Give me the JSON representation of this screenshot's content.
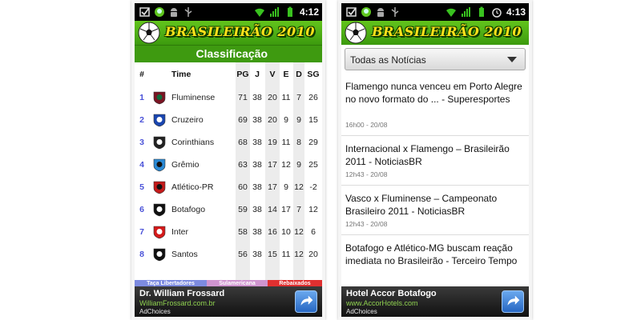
{
  "status_bar": {
    "left_icons": [
      "checkbox-notification-icon",
      "android-notification-icon",
      "android-robot-icon",
      "usb-icon"
    ],
    "right_icons": [
      "wifi-icon",
      "signal-icon",
      "battery-icon",
      "alarm-icon"
    ]
  },
  "left_screen": {
    "clock": "4:12",
    "app_title": "BRASILEIRÃO 2010",
    "section_title": "Classificação",
    "table": {
      "headers": [
        "#",
        "Time",
        "PG",
        "J",
        "V",
        "E",
        "D",
        "SG"
      ],
      "rows": [
        {
          "pos": "1",
          "team": "Fluminense",
          "pg": "71",
          "j": "38",
          "v": "20",
          "e": "11",
          "d": "7",
          "sg": "26",
          "crest": "fluminense-crest-icon",
          "colors": [
            "#7a1423",
            "#0f6b3b"
          ]
        },
        {
          "pos": "2",
          "team": "Cruzeiro",
          "pg": "69",
          "j": "38",
          "v": "20",
          "e": "9",
          "d": "9",
          "sg": "15",
          "crest": "cruzeiro-crest-icon",
          "colors": [
            "#1a46b0",
            "#ffffff"
          ]
        },
        {
          "pos": "3",
          "team": "Corinthians",
          "pg": "68",
          "j": "38",
          "v": "19",
          "e": "11",
          "d": "8",
          "sg": "29",
          "crest": "corinthians-crest-icon",
          "colors": [
            "#222222",
            "#ffffff"
          ]
        },
        {
          "pos": "4",
          "team": "Grêmio",
          "pg": "63",
          "j": "38",
          "v": "17",
          "e": "12",
          "d": "9",
          "sg": "25",
          "crest": "gremio-crest-icon",
          "colors": [
            "#2a8ad6",
            "#111111"
          ]
        },
        {
          "pos": "5",
          "team": "Atlético-PR",
          "pg": "60",
          "j": "38",
          "v": "17",
          "e": "9",
          "d": "12",
          "sg": "-2",
          "crest": "atletico-pr-crest-icon",
          "colors": [
            "#c41a1a",
            "#111111"
          ]
        },
        {
          "pos": "6",
          "team": "Botafogo",
          "pg": "59",
          "j": "38",
          "v": "14",
          "e": "17",
          "d": "7",
          "sg": "12",
          "crest": "botafogo-crest-icon",
          "colors": [
            "#111111",
            "#ffffff"
          ]
        },
        {
          "pos": "7",
          "team": "Inter",
          "pg": "58",
          "j": "38",
          "v": "16",
          "e": "10",
          "d": "12",
          "sg": "6",
          "crest": "inter-crest-icon",
          "colors": [
            "#d41a1a",
            "#ffffff"
          ]
        },
        {
          "pos": "8",
          "team": "Santos",
          "pg": "56",
          "j": "38",
          "v": "15",
          "e": "11",
          "d": "12",
          "sg": "20",
          "crest": "santos-crest-icon",
          "colors": [
            "#111111",
            "#ffffff"
          ]
        }
      ]
    },
    "legend": [
      {
        "label": "Taça Libertadores",
        "color": "#7d8be0"
      },
      {
        "label": "Sulamericana",
        "color": "#d095d0"
      },
      {
        "label": "Rebaixados",
        "color": "#e03030"
      }
    ],
    "ad": {
      "title": "Dr. William Frossard",
      "url": "WilliamFrossard.com.br",
      "choices": "AdChoices"
    }
  },
  "right_screen": {
    "clock": "4:13",
    "app_title": "BRASILEIRÃO 2010",
    "filter": {
      "selected": "Todas as Notícias"
    },
    "news": [
      {
        "title": "Flamengo nunca venceu em Porto Alegre no novo formato do ... - Superesportes",
        "time": "16h00 - 20/08"
      },
      {
        "title": "Internacional x Flamengo – Brasileirão 2011 - NoticiasBR",
        "time": "12h43 - 20/08"
      },
      {
        "title": "Vasco x Fluminense – Campeonato Brasileiro 2011 - NoticiasBR",
        "time": "12h43 - 20/08"
      },
      {
        "title": "Botafogo e Atlético-MG buscam reação imediata no Brasileirão - Terceiro Tempo",
        "time": ""
      }
    ],
    "ad": {
      "title": "Hotel Accor Botafogo",
      "url": "www.AccorHotels.com",
      "choices": "AdChoices"
    }
  },
  "colors": {
    "header_green": "#3e9a10",
    "title_yellow": "#ffe21a",
    "position_blue": "#4a52d8",
    "ad_url_green": "#8fd14f"
  }
}
